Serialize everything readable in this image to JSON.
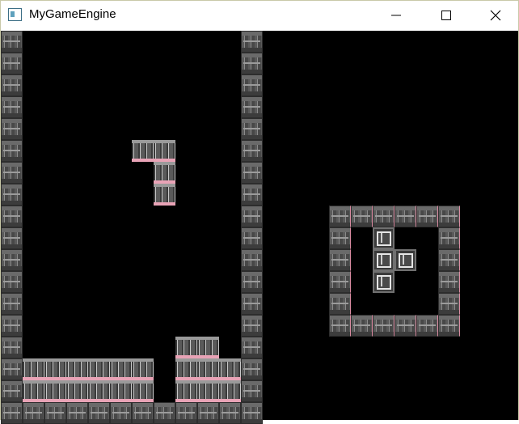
{
  "window": {
    "title": "MyGameEngine",
    "controls": {
      "minimize": "minimize-icon",
      "maximize": "maximize-icon",
      "close": "close-icon"
    }
  },
  "game": {
    "board": {
      "cols": 10,
      "rows": 18,
      "background": "#000000"
    },
    "locked_cells": [
      [
        0,
        15
      ],
      [
        1,
        15
      ],
      [
        2,
        15
      ],
      [
        3,
        15
      ],
      [
        4,
        15
      ],
      [
        5,
        15
      ],
      [
        7,
        15
      ],
      [
        8,
        15
      ],
      [
        9,
        15
      ],
      [
        0,
        16
      ],
      [
        1,
        16
      ],
      [
        2,
        16
      ],
      [
        3,
        16
      ],
      [
        4,
        16
      ],
      [
        5,
        16
      ],
      [
        7,
        16
      ],
      [
        8,
        16
      ],
      [
        9,
        16
      ],
      [
        7,
        14
      ],
      [
        8,
        14
      ]
    ],
    "falling_piece": {
      "shape": "J",
      "cells": [
        [
          5,
          5
        ],
        [
          6,
          5
        ],
        [
          6,
          6
        ],
        [
          6,
          7
        ]
      ]
    },
    "next_piece": {
      "shape": "T",
      "cells": [
        [
          1,
          1
        ],
        [
          1,
          2
        ],
        [
          2,
          2
        ],
        [
          1,
          3
        ]
      ]
    },
    "colors": {
      "accent_pink": "#e8a3b6",
      "wall_gray": "#5a5a5a"
    }
  }
}
